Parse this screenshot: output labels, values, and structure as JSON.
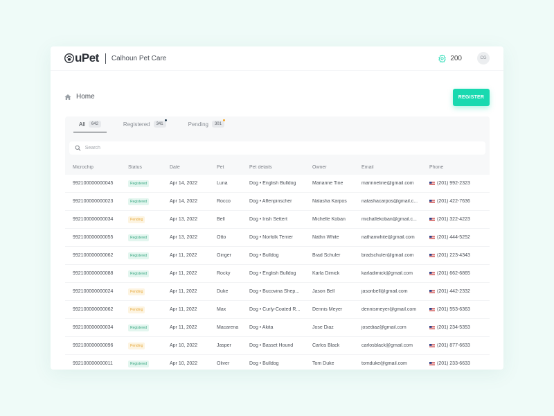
{
  "header": {
    "logo_text": "uPet",
    "clinic_name": "Calhoun Pet Care",
    "points": "200",
    "avatar_initials": "CG"
  },
  "breadcrumb": {
    "label": "Home"
  },
  "actions": {
    "register_label": "REGISTER"
  },
  "colors": {
    "accent": "#19d9b0",
    "registered": "#3aa882",
    "pending": "#e6a83a"
  },
  "tabs": [
    {
      "label": "All",
      "count": "642",
      "active": true,
      "dot": ""
    },
    {
      "label": "Registered",
      "count": "341",
      "active": false,
      "dot": "#1f3b4d"
    },
    {
      "label": "Pending",
      "count": "301",
      "active": false,
      "dot": "#f5a524"
    }
  ],
  "search": {
    "placeholder": "Search",
    "value": ""
  },
  "table": {
    "columns": [
      "Microchip",
      "Status",
      "Date",
      "Pet",
      "Pet details",
      "Owner",
      "Email",
      "Phone"
    ],
    "rows": [
      {
        "microchip": "992100000000045",
        "status": "Registered",
        "date": "Apr 14, 2022",
        "pet": "Luna",
        "details": "Dog • English Bulldog",
        "owner": "Marianne Tine",
        "email": "marinnetine@gmail.com",
        "phone": "(201) 992-2323"
      },
      {
        "microchip": "992100000000023",
        "status": "Registered",
        "date": "Apr 14, 2022",
        "pet": "Rocco",
        "details": "Dog • Affenpinscher",
        "owner": "Nalasha Karpos",
        "email": "natashacarpos@gmail.c...",
        "phone": "(201) 422-7636"
      },
      {
        "microchip": "992100000000034",
        "status": "Pending",
        "date": "Apr 13, 2022",
        "pet": "Bell",
        "details": "Dog • Irish Settert",
        "owner": "Michelle Koban",
        "email": "michallekoban@gmail.c...",
        "phone": "(201) 322-4223"
      },
      {
        "microchip": "992100000000055",
        "status": "Registered",
        "date": "Apr 13, 2022",
        "pet": "Otto",
        "details": "Dog • Norfolk Terrier",
        "owner": "Nathn White",
        "email": "nathanwhite@gmail.com",
        "phone": "(201) 444-5252"
      },
      {
        "microchip": "992100000000062",
        "status": "Registered",
        "date": "Apr 11, 2022",
        "pet": "Ginger",
        "details": "Dog • Bulldog",
        "owner": "Brad Schuler",
        "email": "bradschuler@gmail.com",
        "phone": "(201) 223-4343"
      },
      {
        "microchip": "992100000000088",
        "status": "Registered",
        "date": "Apr 11, 2022",
        "pet": "Rocky",
        "details": "Dog • English Bulldog",
        "owner": "Karla Dimick",
        "email": "karladimick@gmail.com",
        "phone": "(201) 662-6865"
      },
      {
        "microchip": "992100000000024",
        "status": "Pending",
        "date": "Apr 11, 2022",
        "pet": "Duke",
        "details": "Dog • Bucovina Shep...",
        "owner": "Jason Bell",
        "email": "jasonbell@gmail.com",
        "phone": "(201) 442-2332"
      },
      {
        "microchip": "992100000000062",
        "status": "Pending",
        "date": "Apr 11, 2022",
        "pet": "Max",
        "details": "Dog • Curly-Coated R...",
        "owner": "Dennis Meyer",
        "email": "dennismeyer@gmail.com",
        "phone": "(201) 553-6363"
      },
      {
        "microchip": "992100000000034",
        "status": "Registered",
        "date": "Apr 11, 2022",
        "pet": "Macarena",
        "details": "Dog • Akita",
        "owner": "Jose Diaz",
        "email": "josediaz@gmail.com",
        "phone": "(201) 234-5353"
      },
      {
        "microchip": "992100000000096",
        "status": "Pending",
        "date": "Apr 10, 2022",
        "pet": "Jasper",
        "details": "Dog • Basset Hound",
        "owner": "Carlos Black",
        "email": "carlosblack@gmail.com",
        "phone": "(201) 877-6633"
      },
      {
        "microchip": "992100000000011",
        "status": "Registered",
        "date": "Apr 10, 2022",
        "pet": "Oliver",
        "details": "Dog • Bulldog",
        "owner": "Tom Duke",
        "email": "tomduke@gmail.com",
        "phone": "(201) 233-6633"
      }
    ]
  }
}
